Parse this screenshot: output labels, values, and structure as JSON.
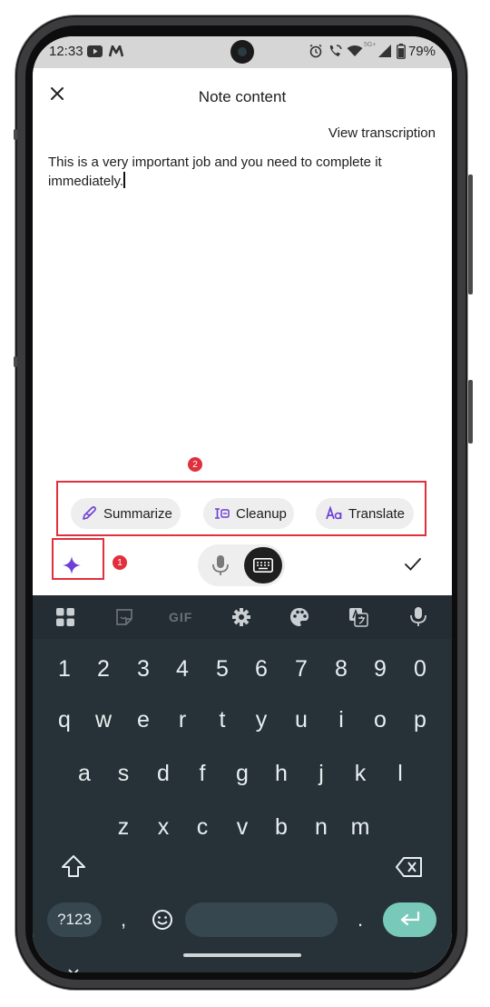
{
  "status_bar": {
    "time": "12:33",
    "battery_percent": "79%",
    "icons": [
      "youtube-icon",
      "m-icon",
      "alarm-icon",
      "wifi-call-icon",
      "wifi-icon",
      "5g-signal-icon",
      "battery-icon"
    ],
    "network_label": "5G+"
  },
  "header": {
    "title": "Note content",
    "close_icon": "close-icon"
  },
  "view_transcription": "View transcription",
  "note": {
    "text": "This is a very important job and you need to complete it immediately."
  },
  "ai_actions": [
    {
      "label": "Summarize",
      "icon": "pen-sparkle-icon"
    },
    {
      "label": "Cleanup",
      "icon": "text-cursor-icon"
    },
    {
      "label": "Translate",
      "icon": "translate-icon"
    }
  ],
  "annotations": {
    "badge_1": "1",
    "badge_2": "2"
  },
  "input_mode": {
    "mic_icon": "microphone-icon",
    "keyboard_icon": "keyboard-icon",
    "ai_icon": "sparkle-icon",
    "confirm_icon": "check-icon"
  },
  "keyboard": {
    "toolbar_icons": [
      "apps-grid-icon",
      "sticker-icon",
      "gif-icon",
      "settings-gear-icon",
      "palette-icon",
      "translate-icon",
      "microphone-icon"
    ],
    "gif_label": "GIF",
    "row_numbers": [
      "1",
      "2",
      "3",
      "4",
      "5",
      "6",
      "7",
      "8",
      "9",
      "0"
    ],
    "row_1": [
      "q",
      "w",
      "e",
      "r",
      "t",
      "y",
      "u",
      "i",
      "o",
      "p"
    ],
    "row_2": [
      "a",
      "s",
      "d",
      "f",
      "g",
      "h",
      "j",
      "k",
      "l"
    ],
    "row_3": [
      "z",
      "x",
      "c",
      "v",
      "b",
      "n",
      "m"
    ],
    "symbols_key": "?123",
    "comma_key": ",",
    "period_key": ".",
    "colors": {
      "keyboard_bg": "#263238",
      "enter_bg": "#79c9bb",
      "accent_purple": "#6c3fd6",
      "annotation_red": "#e0303d"
    }
  }
}
